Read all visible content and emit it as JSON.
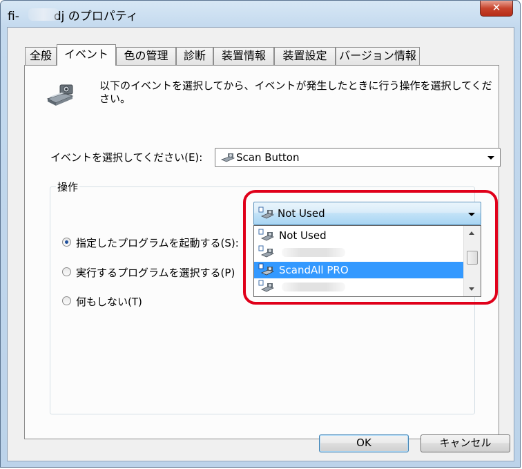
{
  "window": {
    "title_prefix": "fi-",
    "title_suffix": "dj のプロパティ",
    "close_label": "✕"
  },
  "tabs": [
    {
      "label": "全般"
    },
    {
      "label": "イベント"
    },
    {
      "label": "色の管理"
    },
    {
      "label": "診断"
    },
    {
      "label": "装置情報"
    },
    {
      "label": "装置設定"
    },
    {
      "label": "バージョン情報"
    }
  ],
  "panel": {
    "description": "以下のイベントを選択してから、イベントが発生したときに行う操作を選択してください。",
    "event_label": "イベントを選択してください(E):",
    "event_value": "Scan Button",
    "group_label": "操作",
    "radio_start": "指定したプログラムを起動する(S):",
    "radio_choose": "実行するプログラムを選択する(P)",
    "radio_none": "何もしない(T)",
    "program_value": "Not Used",
    "program_options": [
      {
        "label": "Not Used"
      },
      {
        "label": ""
      },
      {
        "label": "ScandAll PRO"
      },
      {
        "label": ""
      }
    ]
  },
  "buttons": {
    "ok": "OK",
    "cancel": "キャンセル"
  },
  "colors": {
    "highlight": "#e0001a",
    "selection": "#3399ff"
  }
}
